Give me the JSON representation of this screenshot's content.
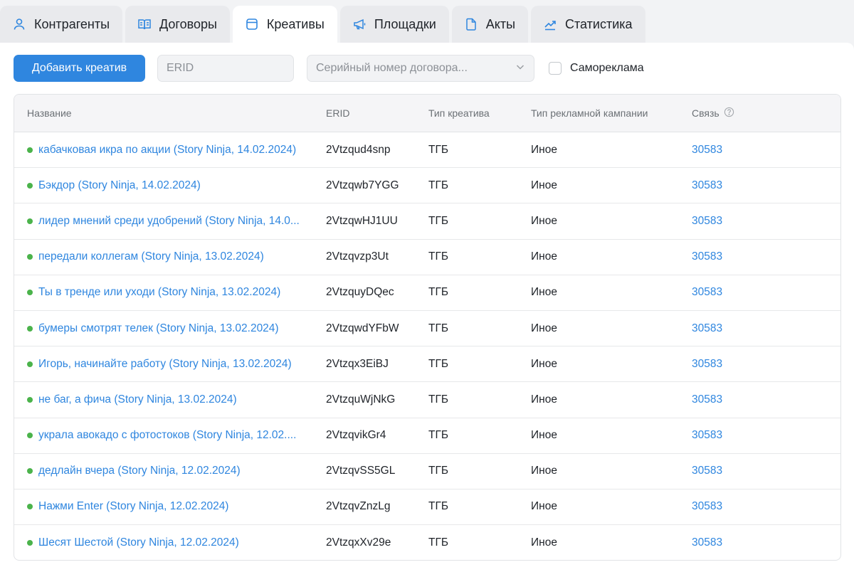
{
  "tabs": [
    {
      "label": "Контрагенты",
      "icon": "user-icon",
      "active": false
    },
    {
      "label": "Договоры",
      "icon": "book-icon",
      "active": false
    },
    {
      "label": "Креативы",
      "icon": "window-icon",
      "active": true
    },
    {
      "label": "Площадки",
      "icon": "megaphone-icon",
      "active": false
    },
    {
      "label": "Акты",
      "icon": "document-icon",
      "active": false
    },
    {
      "label": "Статистика",
      "icon": "chart-icon",
      "active": false
    }
  ],
  "toolbar": {
    "add_label": "Добавить креатив",
    "erid_placeholder": "ERID",
    "contract_placeholder": "Серийный номер договора...",
    "self_ad_label": "Самореклама"
  },
  "colors": {
    "accent": "#2f86df",
    "status_active": "#4bb34b"
  },
  "table": {
    "columns": [
      "Название",
      "ERID",
      "Тип креатива",
      "Тип рекламной кампании",
      "Связь"
    ],
    "rows": [
      {
        "name": "кабачковая икра по акции (Story Ninja, 14.02.2024)",
        "erid": "2Vtzqud4snp",
        "type": "ТГБ",
        "campaign": "Иное",
        "link": "30583"
      },
      {
        "name": "Бэкдор (Story Ninja, 14.02.2024)",
        "erid": "2Vtzqwb7YGG",
        "type": "ТГБ",
        "campaign": "Иное",
        "link": "30583"
      },
      {
        "name": "лидер мнений среди удобрений (Story Ninja, 14.0...",
        "erid": "2VtzqwHJ1UU",
        "type": "ТГБ",
        "campaign": "Иное",
        "link": "30583"
      },
      {
        "name": "передали коллегам (Story Ninja, 13.02.2024)",
        "erid": "2Vtzqvzp3Ut",
        "type": "ТГБ",
        "campaign": "Иное",
        "link": "30583"
      },
      {
        "name": "Ты в тренде или уходи (Story Ninja, 13.02.2024)",
        "erid": "2VtzquyDQec",
        "type": "ТГБ",
        "campaign": "Иное",
        "link": "30583"
      },
      {
        "name": "бумеры смотрят телек (Story Ninja, 13.02.2024)",
        "erid": "2VtzqwdYFbW",
        "type": "ТГБ",
        "campaign": "Иное",
        "link": "30583"
      },
      {
        "name": "Игорь, начинайте работу (Story Ninja, 13.02.2024)",
        "erid": "2Vtzqx3EiBJ",
        "type": "ТГБ",
        "campaign": "Иное",
        "link": "30583"
      },
      {
        "name": "не баг, а фича (Story Ninja, 13.02.2024)",
        "erid": "2VtzquWjNkG",
        "type": "ТГБ",
        "campaign": "Иное",
        "link": "30583"
      },
      {
        "name": "украла авокадо с фотостоков (Story Ninja, 12.02....",
        "erid": "2VtzqvikGr4",
        "type": "ТГБ",
        "campaign": "Иное",
        "link": "30583"
      },
      {
        "name": "дедлайн вчера (Story Ninja, 12.02.2024)",
        "erid": "2VtzqvSS5GL",
        "type": "ТГБ",
        "campaign": "Иное",
        "link": "30583"
      },
      {
        "name": "Нажми Enter (Story Ninja, 12.02.2024)",
        "erid": "2VtzqvZnzLg",
        "type": "ТГБ",
        "campaign": "Иное",
        "link": "30583"
      },
      {
        "name": "Шесят Шестой (Story Ninja, 12.02.2024)",
        "erid": "2VtzqxXv29e",
        "type": "ТГБ",
        "campaign": "Иное",
        "link": "30583"
      }
    ]
  }
}
